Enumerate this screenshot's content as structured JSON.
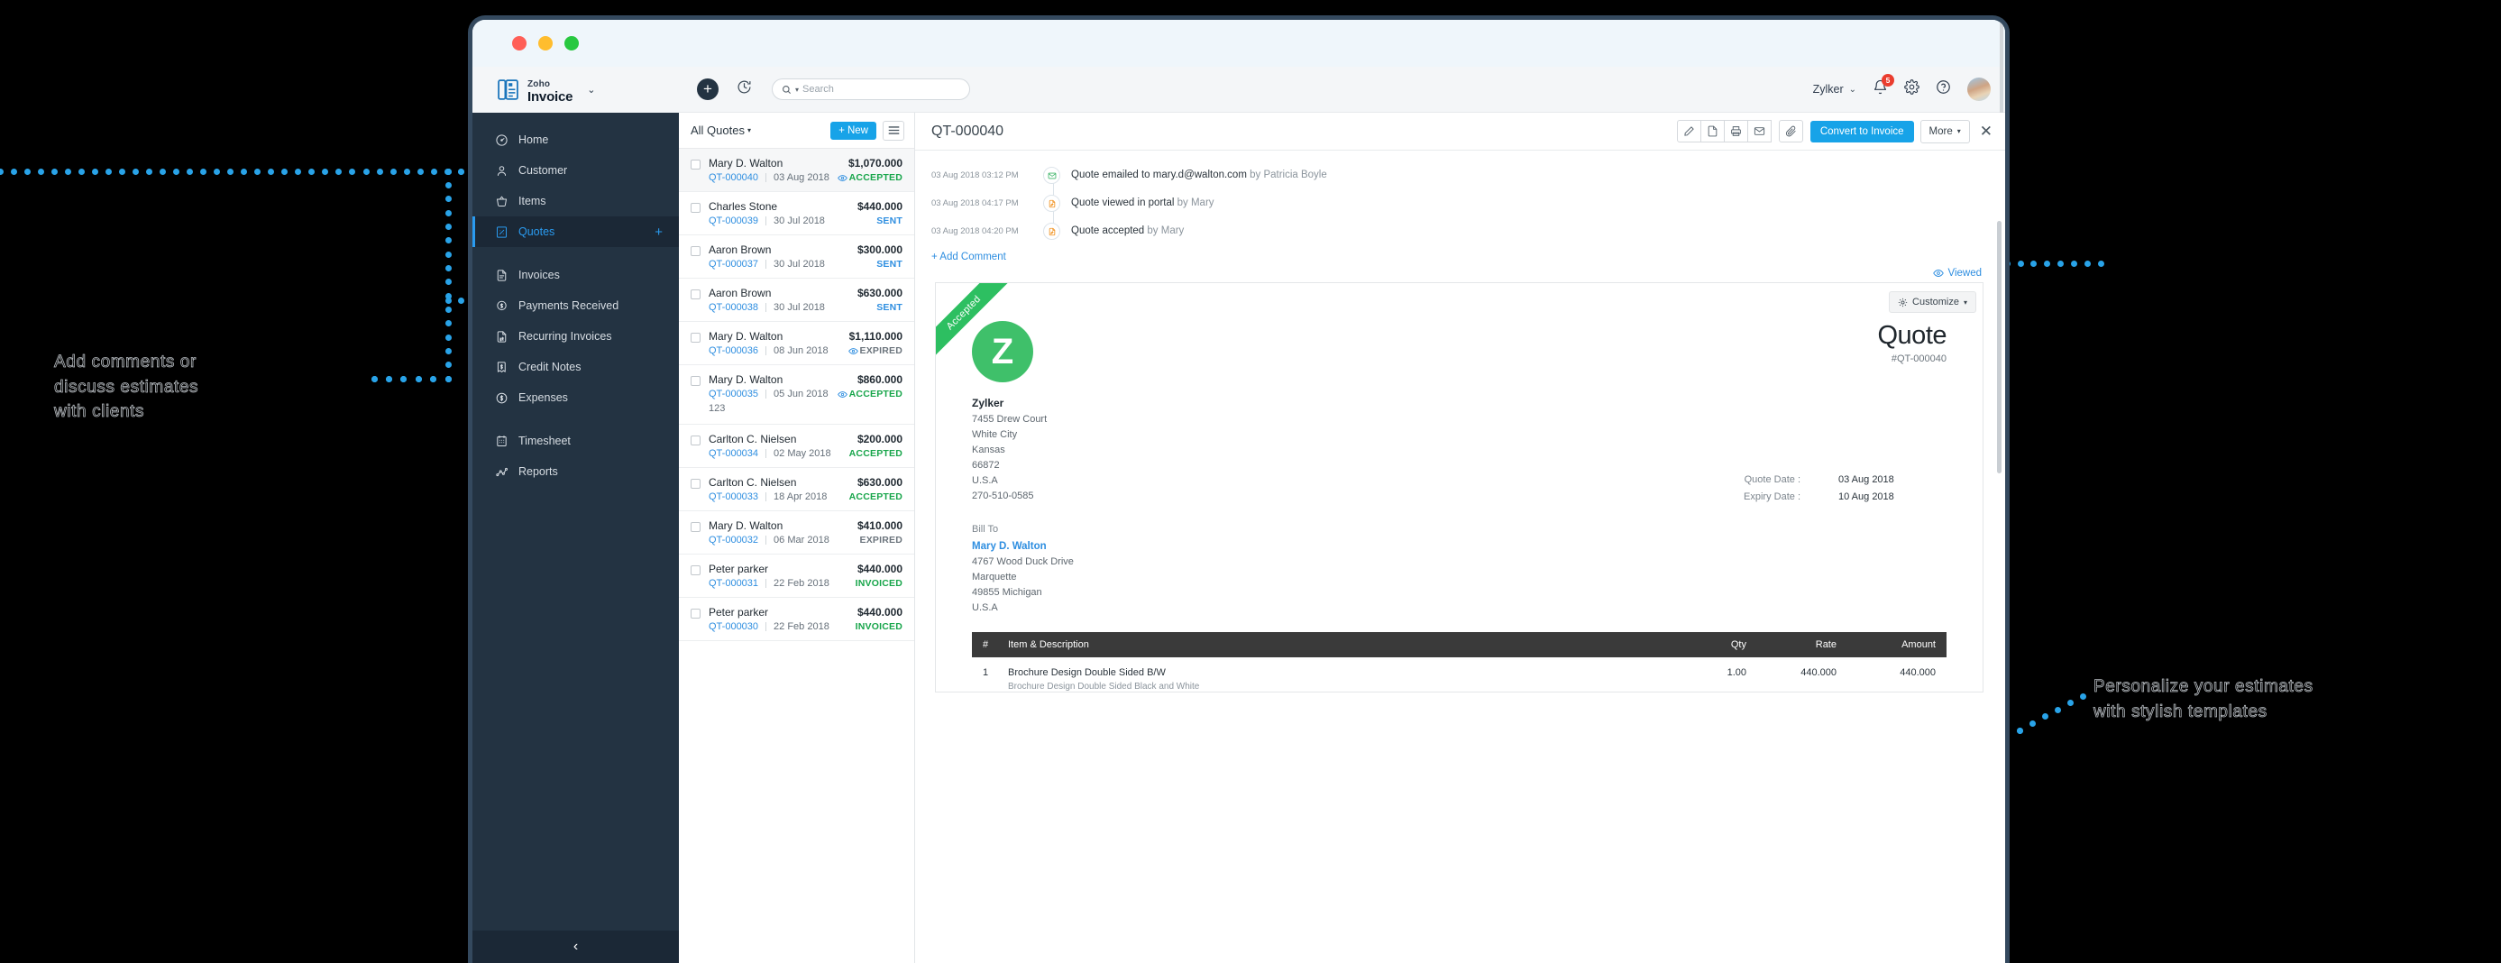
{
  "window": {
    "traffic_lights": [
      "close",
      "minimize",
      "zoom"
    ]
  },
  "brand": {
    "zoho": "Zoho",
    "product": "Invoice",
    "chevron": "⌄"
  },
  "sidebar": {
    "items": [
      {
        "label": "Home",
        "icon": "dashboard-icon",
        "active": false,
        "plus": false
      },
      {
        "label": "Customer",
        "icon": "user-icon",
        "active": false,
        "plus": false
      },
      {
        "label": "Items",
        "icon": "basket-icon",
        "active": false,
        "plus": false
      },
      {
        "label": "Quotes",
        "icon": "quotes-icon",
        "active": true,
        "plus": true
      },
      {
        "label": "Invoices",
        "icon": "invoice-doc-icon",
        "active": false,
        "plus": false
      },
      {
        "label": "Payments Received",
        "icon": "payment-dollar-icon",
        "active": false,
        "plus": false
      },
      {
        "label": "Recurring Invoices",
        "icon": "recurring-doc-icon",
        "active": false,
        "plus": false
      },
      {
        "label": "Credit Notes",
        "icon": "credit-note-icon",
        "active": false,
        "plus": false
      },
      {
        "label": "Expenses",
        "icon": "expense-dollar-icon",
        "active": false,
        "plus": false
      },
      {
        "label": "Timesheet",
        "icon": "timesheet-icon",
        "active": false,
        "plus": false
      },
      {
        "label": "Reports",
        "icon": "reports-chart-icon",
        "active": false,
        "plus": false
      }
    ],
    "collapse_glyph": "‹"
  },
  "topbar": {
    "add_label": "+",
    "search_placeholder": "Search",
    "org_name": "Zylker",
    "org_chevron": "⌄",
    "notification_count": "5"
  },
  "list": {
    "title": "All Quotes",
    "caret": "▾",
    "new_label": "New",
    "rows": [
      {
        "name": "Mary D. Walton",
        "amount": "$1,070.000",
        "number": "QT-000040",
        "date": "03 Aug 2018",
        "status": "ACCEPTED",
        "eye": true,
        "extra": "",
        "selected": true
      },
      {
        "name": "Charles Stone",
        "amount": "$440.000",
        "number": "QT-000039",
        "date": "30 Jul 2018",
        "status": "SENT",
        "eye": false,
        "extra": "",
        "selected": false
      },
      {
        "name": "Aaron Brown",
        "amount": "$300.000",
        "number": "QT-000037",
        "date": "30 Jul 2018",
        "status": "SENT",
        "eye": false,
        "extra": "",
        "selected": false
      },
      {
        "name": "Aaron Brown",
        "amount": "$630.000",
        "number": "QT-000038",
        "date": "30 Jul 2018",
        "status": "SENT",
        "eye": false,
        "extra": "",
        "selected": false
      },
      {
        "name": "Mary D. Walton",
        "amount": "$1,110.000",
        "number": "QT-000036",
        "date": "08 Jun 2018",
        "status": "EXPIRED",
        "eye": true,
        "extra": "",
        "selected": false
      },
      {
        "name": "Mary D. Walton",
        "amount": "$860.000",
        "number": "QT-000035",
        "date": "05 Jun 2018",
        "status": "ACCEPTED",
        "eye": true,
        "extra": "123",
        "selected": false
      },
      {
        "name": "Carlton C. Nielsen",
        "amount": "$200.000",
        "number": "QT-000034",
        "date": "02 May 2018",
        "status": "ACCEPTED",
        "eye": false,
        "extra": "",
        "selected": false
      },
      {
        "name": "Carlton C. Nielsen",
        "amount": "$630.000",
        "number": "QT-000033",
        "date": "18 Apr 2018",
        "status": "ACCEPTED",
        "eye": false,
        "extra": "",
        "selected": false
      },
      {
        "name": "Mary D. Walton",
        "amount": "$410.000",
        "number": "QT-000032",
        "date": "06 Mar 2018",
        "status": "EXPIRED",
        "eye": false,
        "extra": "",
        "selected": false
      },
      {
        "name": "Peter parker",
        "amount": "$440.000",
        "number": "QT-000031",
        "date": "22 Feb 2018",
        "status": "INVOICED",
        "eye": false,
        "extra": "",
        "selected": false
      },
      {
        "name": "Peter parker",
        "amount": "$440.000",
        "number": "QT-000030",
        "date": "22 Feb 2018",
        "status": "INVOICED",
        "eye": false,
        "extra": "",
        "selected": false
      }
    ]
  },
  "detail": {
    "number": "QT-000040",
    "toolbar": {
      "edit": "edit-pencil-icon",
      "pdf": "pdf-file-icon",
      "print": "printer-icon",
      "email": "envelope-icon",
      "attach": "paperclip-icon",
      "convert_label": "Convert to Invoice",
      "more_label": "More",
      "more_caret": "▾",
      "close_glyph": "✕"
    },
    "timeline": [
      {
        "time": "03 Aug 2018 03:12 PM",
        "text": "Quote emailed to mary.d@walton.com",
        "by": "by Patricia Boyle",
        "icon": "envelope-green-icon"
      },
      {
        "time": "03 Aug 2018 04:17 PM",
        "text": "Quote viewed in portal",
        "by": "by Mary",
        "icon": "doc-edit-orange-icon"
      },
      {
        "time": "03 Aug 2018 04:20 PM",
        "text": "Quote accepted",
        "by": "by Mary",
        "icon": "doc-edit-orange-icon"
      }
    ],
    "add_comment_label": "+ Add Comment",
    "viewed_label": "Viewed",
    "customize_label": "Customize",
    "customize_caret": "▾"
  },
  "document": {
    "ribbon": "Accepted",
    "logo_letter": "Z",
    "from": {
      "name": "Zylker",
      "lines": [
        "7455 Drew Court",
        "White City",
        "Kansas",
        "66872",
        "U.S.A",
        "270-510-0585"
      ]
    },
    "title": "Quote",
    "number": "#QT-000040",
    "bill_to_label": "Bill To",
    "bill_to": {
      "name": "Mary D. Walton",
      "lines": [
        "4767 Wood Duck Drive",
        "Marquette",
        "49855 Michigan",
        "U.S.A"
      ]
    },
    "dates": [
      {
        "label": "Quote Date :",
        "value": "03 Aug 2018"
      },
      {
        "label": "Expiry Date :",
        "value": "10 Aug 2018"
      }
    ],
    "table": {
      "headers": {
        "no": "#",
        "desc": "Item & Description",
        "qty": "Qty",
        "rate": "Rate",
        "amount": "Amount"
      },
      "rows": [
        {
          "no": "1",
          "desc": "Brochure Design Double Sided B/W",
          "sub": "Brochure Design Double Sided Black and White",
          "qty": "1.00",
          "rate": "440.000",
          "amount": "440.000"
        }
      ]
    }
  },
  "annotations": {
    "left": "Add comments or\ndiscuss estimates\nwith clients",
    "right": "Personalize your estimates\nwith stylish templates"
  },
  "colors": {
    "accent_blue": "#17a3e8",
    "link_blue": "#2e8ee0",
    "sidebar_dark": "#233342",
    "green_status": "#17a54a",
    "ribbon_green": "#2dbf61",
    "badge_red": "#ea3d2f",
    "callout_blue": "#29a3e8",
    "callout_red": "#ea1c25"
  }
}
